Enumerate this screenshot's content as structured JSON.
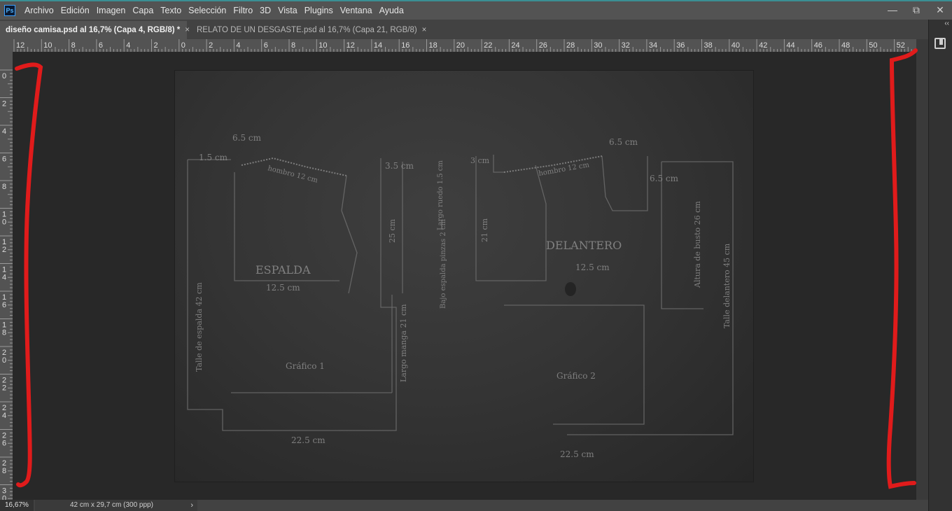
{
  "app": {
    "logo": "Ps",
    "menu": [
      "Archivo",
      "Edición",
      "Imagen",
      "Capa",
      "Texto",
      "Selección",
      "Filtro",
      "3D",
      "Vista",
      "Plugins",
      "Ventana",
      "Ayuda"
    ],
    "window_controls": [
      "—",
      "⧉",
      "✕"
    ]
  },
  "tabs": [
    {
      "title": "diseño camisa.psd al 16,7% (Capa 4, RGB/8) *",
      "active": true,
      "close": "×"
    },
    {
      "title": "RELATO DE UN DESGASTE.psd al 16,7% (Capa 21, RGB/8)",
      "active": false,
      "close": "×"
    }
  ],
  "ruler_h_labels": [
    "12",
    "10",
    "8",
    "6",
    "4",
    "2",
    "0",
    "2",
    "4",
    "6",
    "8",
    "10",
    "12",
    "14",
    "16",
    "18",
    "20",
    "22",
    "24",
    "26",
    "28",
    "30",
    "32",
    "34",
    "36",
    "38",
    "40",
    "42",
    "44",
    "46",
    "48",
    "50",
    "52"
  ],
  "ruler_v_labels": [
    "0",
    "2",
    "4",
    "6",
    "8",
    "10",
    "12",
    "14",
    "16",
    "18",
    "20",
    "22",
    "24",
    "26",
    "28",
    "30"
  ],
  "canvas_text": {
    "m1": "6.5 cm",
    "m2": "1.5 cm",
    "m3": "hombro 12 cm",
    "m4": "3.5 cm",
    "m5": "ESPALDA",
    "m6": "12.5 cm",
    "m7": "25 cm",
    "m8": "Talle de espalda 42 cm",
    "m9": "Largo manga 21 cm",
    "m10": "Gráfico 1",
    "m11": "22.5 cm",
    "m12": "3 cm",
    "m13": "hombro 12 cm",
    "m14": "6.5 cm",
    "m15": "6.5 cm",
    "m16": "21 cm",
    "m17": "DELANTERO",
    "m18": "12.5 cm",
    "m19": "Altura de busto 26 cm",
    "m20": "Talle delantero 45 cm",
    "m21": "Gráfico 2",
    "m22": "22.5 cm",
    "m23": "Bajo espalda pinzas 2 cm",
    "m24": "Largo ruedo 1.5 cm"
  },
  "status": {
    "zoom": "16,67%",
    "doc_info": "42 cm x 29,7 cm (300 ppp)",
    "arrow": "›"
  },
  "colors": {
    "menubar": "#535353",
    "canvas_bg": "#282828",
    "marker": "#e01b1b",
    "accent": "#3a8f94"
  }
}
